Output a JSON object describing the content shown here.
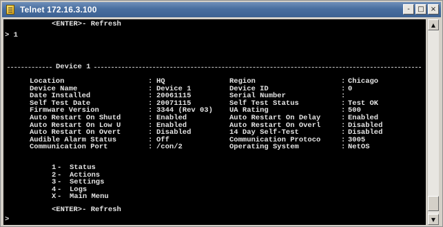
{
  "window": {
    "title": "Telnet 172.16.3.100",
    "icon": "telnet-app-icon",
    "controls": {
      "minimize": "-",
      "maximize": "□",
      "close": "×"
    }
  },
  "terminal": {
    "top_refresh": "<ENTER>- Refresh",
    "prompt_input": "> 1",
    "section_title": "Device 1",
    "fields_left": [
      {
        "label": "Location",
        "value": "HQ"
      },
      {
        "label": "Device Name",
        "value": "Device 1"
      },
      {
        "label": "Date Installed",
        "value": "20061115"
      },
      {
        "label": "Self Test Date",
        "value": "20071115"
      },
      {
        "label": "Firmware Version",
        "value": "3344 (Rev 03)"
      },
      {
        "label": "Auto Restart On Shutd",
        "value": "Enabled"
      },
      {
        "label": "Auto Restart On Low U",
        "value": "Enabled"
      },
      {
        "label": "Auto Restart On Overt",
        "value": "Disabled"
      },
      {
        "label": "Audible Alarm Status",
        "value": "Off"
      },
      {
        "label": "Communication Port",
        "value": "/con/2"
      }
    ],
    "fields_right": [
      {
        "label": "Region",
        "value": "Chicago"
      },
      {
        "label": "Device ID",
        "value": "0"
      },
      {
        "label": "Serial Number",
        "value": ""
      },
      {
        "label": "Self Test Status",
        "value": "Test OK"
      },
      {
        "label": "UA Rating",
        "value": "500"
      },
      {
        "label": "Auto Restart On Delay",
        "value": "Enabled"
      },
      {
        "label": "Auto Restart On Overl",
        "value": "Disabled"
      },
      {
        "label": "14 Day Self-Test",
        "value": "Disabled"
      },
      {
        "label": "Communication Protoco",
        "value": "3005"
      },
      {
        "label": "Operating System",
        "value": "NetOS"
      }
    ],
    "menu": [
      {
        "key": "1",
        "label": "Status"
      },
      {
        "key": "2",
        "label": "Actions"
      },
      {
        "key": "3",
        "label": "Settings"
      },
      {
        "key": "4",
        "label": "Logs"
      },
      {
        "key": "X",
        "label": "Main Menu"
      }
    ],
    "bottom_refresh": "<ENTER>- Refresh",
    "bottom_prompt": ">"
  },
  "colors": {
    "terminal_bg": "#000000",
    "terminal_fg": "#e4e4e4",
    "titlebar": "#496e9f"
  }
}
